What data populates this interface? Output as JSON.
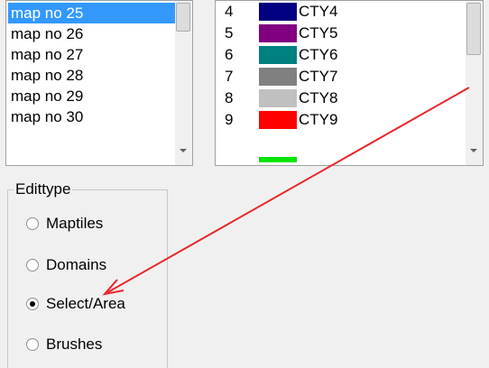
{
  "map_list": {
    "items": [
      {
        "label": "map no 25",
        "selected": true
      },
      {
        "label": "map no 26",
        "selected": false
      },
      {
        "label": "map no 27",
        "selected": false
      },
      {
        "label": "map no 28",
        "selected": false
      },
      {
        "label": "map no 29",
        "selected": false
      },
      {
        "label": "map no 30",
        "selected": false
      }
    ]
  },
  "color_list": {
    "items": [
      {
        "num": "4",
        "label": "CTY4",
        "color": "#000080"
      },
      {
        "num": "5",
        "label": "CTY5",
        "color": "#800080"
      },
      {
        "num": "6",
        "label": "CTY6",
        "color": "#008080"
      },
      {
        "num": "7",
        "label": "CTY7",
        "color": "#808080"
      },
      {
        "num": "8",
        "label": "CTY8",
        "color": "#c0c0c0"
      },
      {
        "num": "9",
        "label": "CTY9",
        "color": "#ff0000"
      }
    ],
    "partial_next_color": "#00e600"
  },
  "edittype": {
    "title": "Edittype",
    "options": [
      {
        "label": "Maptiles",
        "checked": false
      },
      {
        "label": "Domains",
        "checked": false
      },
      {
        "label": "Select/Area",
        "checked": true
      },
      {
        "label": "Brushes",
        "checked": false
      }
    ]
  },
  "annotation": {
    "color": "#e8262b",
    "kind": "arrow"
  }
}
